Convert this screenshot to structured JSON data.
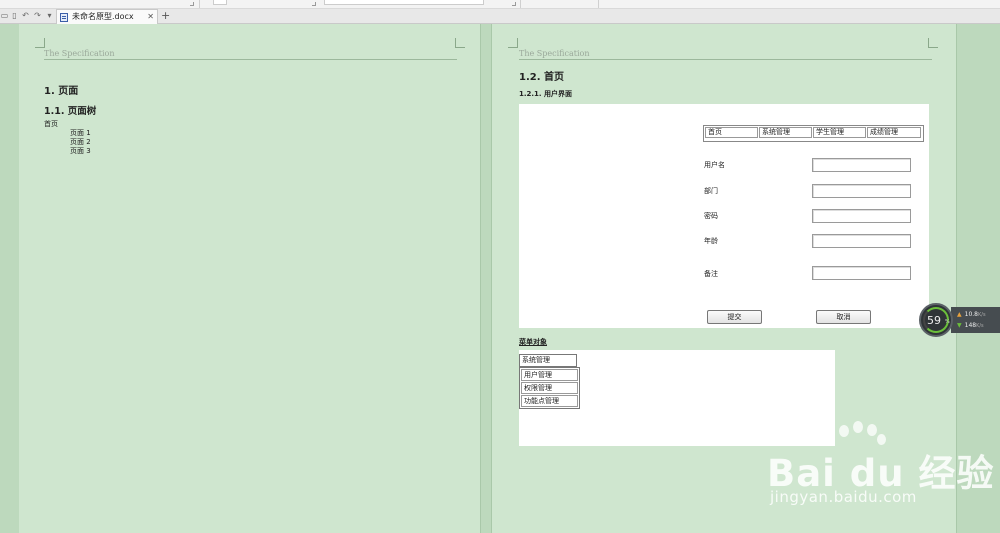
{
  "tabbar": {
    "doc_title": "未命名原型.docx",
    "close_glyph": "✕",
    "new_tab_glyph": "+"
  },
  "left_page": {
    "header": "The Specification",
    "h1": "1. 页面",
    "h2": "1.1. 页面树",
    "tree_root": "首页",
    "tree_children": [
      "页面 1",
      "页面 2",
      "页面 3"
    ]
  },
  "right_page": {
    "header": "The Specification",
    "h1": "1.2. 首页",
    "h3": "1.2.1. 用户界面",
    "nav": [
      "首页",
      "系统管理",
      "学生管理",
      "成绩管理"
    ],
    "form": {
      "labels": [
        "用户名",
        "部门",
        "密码",
        "年龄",
        "备注"
      ],
      "submit": "提交",
      "cancel": "取消"
    },
    "menu_heading": "菜单对象",
    "menu_top": "系统管理",
    "menu_items": [
      "用户管理",
      "权限管理",
      "功能点管理"
    ]
  },
  "net_widget": {
    "percent": "59",
    "unit": "%",
    "up_value": "10.8",
    "down_value": "148",
    "speed_unit": "K/s"
  },
  "watermark": {
    "brand": "Bai du 经验",
    "url": "jingyan.baidu.com"
  },
  "colors": {
    "page_bg": "#cfe6cf",
    "gauge_green": "#6bbf3a"
  }
}
